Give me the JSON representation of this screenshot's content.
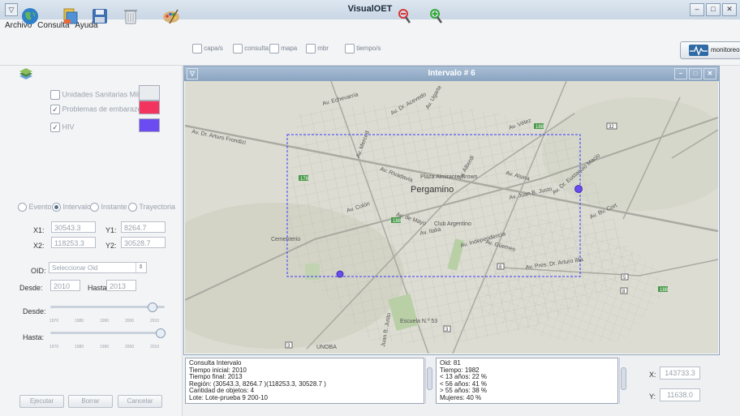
{
  "window": {
    "title": "VisualOET"
  },
  "menu": [
    "Archivo",
    "Consulta",
    "Ayuda"
  ],
  "toolbar": {
    "checks": [
      "capa/s",
      "consulta",
      "mapa",
      "mbr",
      "tiempo/s"
    ],
    "monitor_label": "monitoreo"
  },
  "layers": [
    {
      "label": "Unidades Sanitarias Milv...",
      "checked": false,
      "color": "#e9ecef"
    },
    {
      "label": "Problemas de embarazo",
      "checked": true,
      "color": "#f2345f"
    },
    {
      "label": "HIV",
      "checked": true,
      "color": "#6a4cf0"
    }
  ],
  "query_types": [
    {
      "label": "Evento",
      "selected": false
    },
    {
      "label": "Intervalo",
      "selected": true
    },
    {
      "label": "Instante",
      "selected": false
    },
    {
      "label": "Trayectoria",
      "selected": false
    }
  ],
  "coords": {
    "x1_label": "X1:",
    "x1": "30543.3",
    "y1_label": "Y1:",
    "y1": "8264.7",
    "x2_label": "X2:",
    "x2": "118253.3",
    "y2_label": "Y2:",
    "y2": "30528.7"
  },
  "oid": {
    "label": "OID:",
    "placeholder": "Seleccionar Oid"
  },
  "dates": {
    "desde_label": "Desde:",
    "desde": "2010",
    "hasta_label": "Hasta:",
    "hasta": "2013"
  },
  "sliders": {
    "desde_label": "Desde:",
    "hasta_label": "Hasta:",
    "ticks": [
      "1970",
      "1980",
      "1990",
      "2000",
      "2010"
    ],
    "desde_value": 2010,
    "hasta_value": 2013
  },
  "buttons": {
    "run": "Ejecutar",
    "clear": "Borrar",
    "cancel": "Cancelar"
  },
  "subwindow": {
    "title": "Intervalo # 6"
  },
  "map": {
    "city": "Pergamino",
    "labels": [
      "Av. Dr. Arturo Frondizi",
      "Av. de Mayo",
      "Av. Juan B. Justo",
      "Av. Colón",
      "Av. Pres. Dr. Arturo Illia",
      "Av. Dr. Eustaquio Macio",
      "Av. Dr. Acevedo",
      "Av. Ugarte",
      "Av. Merced",
      "Av. Rivadavia",
      "Av. Alberdi",
      "Av. Güemes",
      "Av. Italia",
      "Av. Independencia",
      "Av. Bv. Cort",
      "Av. Echevarría",
      "Av. Vélez",
      "Av. Alsina",
      "Cementerio",
      "Plaza Almirante Brown",
      "Club Argentino",
      "Escuela N.º 53",
      "UNOBA",
      "Juan B. Justo"
    ],
    "shields": [
      "178",
      "188",
      "188",
      "188",
      "8",
      "8",
      "32",
      "3",
      "3",
      "5",
      "5"
    ]
  },
  "info_query": [
    "Consulta Intervalo",
    "Tiempo inicial: 2010",
    "Tiempo final: 2013",
    "Región: (30543.3, 8264.7 )(118253.3, 30528.7 )",
    "Cantidad de objetos: 4",
    "Lote: Lote-prueba 9  200-10"
  ],
  "info_object": [
    "Oid: 81",
    "Tiempo: 1982",
    "< 13 años: 22 %",
    "< 56 años: 41 %",
    "> 55 años: 38 %",
    "Mujeres: 40 %"
  ],
  "cursor": {
    "x_label": "X:",
    "x": "143733.3",
    "y_label": "Y:",
    "y": "11638.0"
  }
}
